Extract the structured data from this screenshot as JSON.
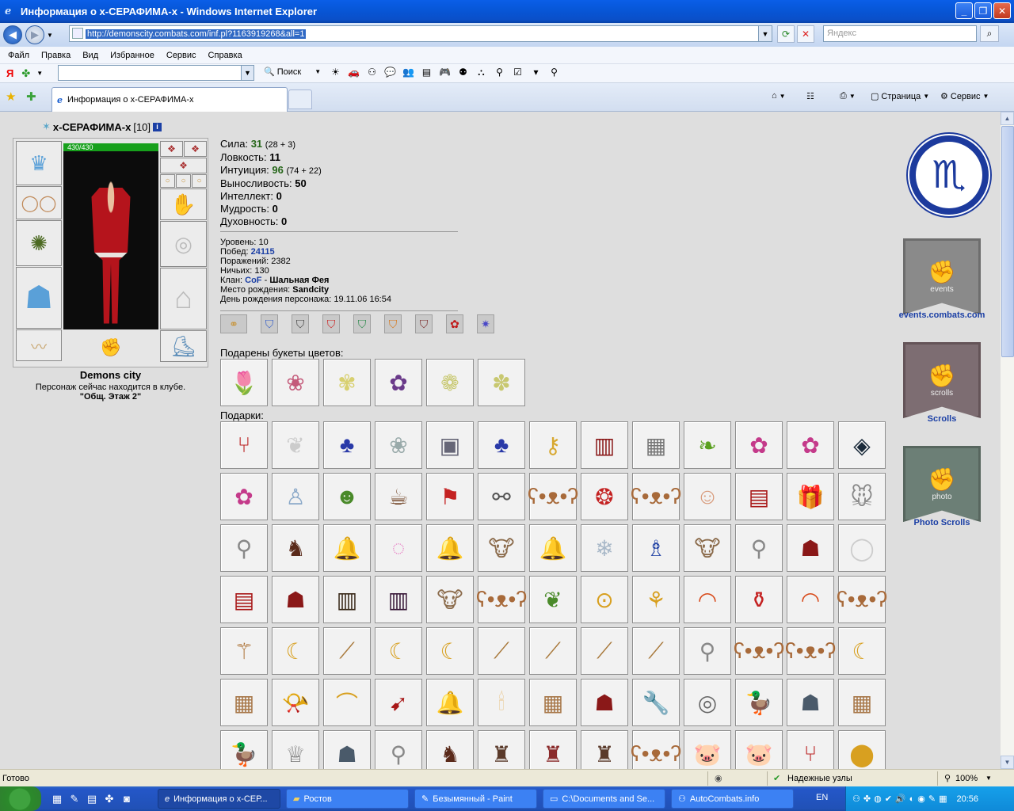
{
  "window": {
    "title": "Информация о x-СЕРАФИМА-x - Windows Internet Explorer"
  },
  "address": {
    "url": "http://demonscity.combats.com/inf.pl?1163919268&all=1",
    "search_placeholder": "Яндекс"
  },
  "menu": [
    "Файл",
    "Правка",
    "Вид",
    "Избранное",
    "Сервис",
    "Справка"
  ],
  "yandexbar": {
    "logo": "Я",
    "search_label": "Поиск"
  },
  "tab": {
    "label": "Информация о x-СЕРАФИМА-x"
  },
  "commandbar": {
    "page": "Страница",
    "service": "Сервис"
  },
  "character": {
    "name": "x-СЕРАФИМА-x",
    "level": "[10]",
    "hp": "430/430",
    "city": "Demons city",
    "location_text": "Персонаж сейчас находится в клубе.",
    "room": "\"Общ. Этаж 2\""
  },
  "stats": [
    {
      "label": "Сила:",
      "value": "31",
      "extra": "(28 + 3)",
      "green": true
    },
    {
      "label": "Ловкость:",
      "value": "11",
      "extra": "",
      "green": false
    },
    {
      "label": "Интуиция:",
      "value": "96",
      "extra": "(74 + 22)",
      "green": true
    },
    {
      "label": "Выносливость:",
      "value": "50",
      "extra": "",
      "green": false
    },
    {
      "label": "Интеллект:",
      "value": "0",
      "extra": "",
      "green": false
    },
    {
      "label": "Мудрость:",
      "value": "0",
      "extra": "",
      "green": false
    },
    {
      "label": "Духовность:",
      "value": "0",
      "extra": "",
      "green": false
    }
  ],
  "info": {
    "level_label": "Уровень:",
    "level": "10",
    "wins_label": "Побед:",
    "wins": "24115",
    "losses_label": "Поражений:",
    "losses": "2382",
    "draws_label": "Ничьих:",
    "draws": "130",
    "clan_label": "Клан:",
    "clan_short": "CoF",
    "clan_sep": "-",
    "clan_name": "Шальная Фея",
    "birthplace_label": "Место рождения:",
    "birthplace": "Sandcity",
    "birthday_label": "День рождения персонажа:",
    "birthday": "19.11.06 16:54"
  },
  "sections": {
    "bouquets": "Подарены букеты цветов:",
    "gifts": "Подарки:"
  },
  "right_links": {
    "events": "events.combats.com",
    "events_banner": "events",
    "scrolls": "Scrolls",
    "scrolls_banner": "scrolls",
    "photo": "Photo Scrolls",
    "photo_banner": "photo"
  },
  "status": {
    "text": "Готово",
    "zone": "Надежные узлы",
    "zoom": "100%"
  },
  "taskbar": {
    "items": [
      "Информация о x-СЕР...",
      "Ростов",
      "Безымянный - Paint",
      "C:\\Documents and Se...",
      "AutoCombats.info"
    ],
    "lang": "EN",
    "clock": "20:56"
  }
}
